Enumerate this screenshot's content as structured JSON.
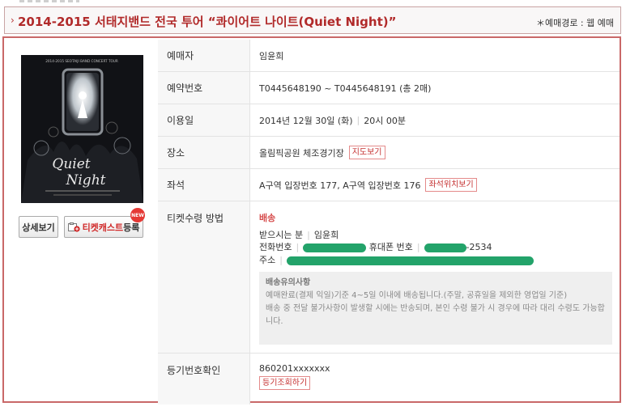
{
  "header": {
    "title": "2014-2015 서태지밴드 전국 투어 “콰이어트 나이트(Quiet Night)”",
    "route_label": "＊예매경로 : 웹 예매"
  },
  "poster": {
    "top_text": "2014-2015 SEOTAIJI BAND CONCERT TOUR",
    "logo_line1": "Quiet",
    "logo_line2": "Night"
  },
  "buttons": {
    "detail": "상세보기",
    "ticketcast_red": "티켓캐스트",
    "ticketcast_rest": "등록",
    "new_badge": "NEW"
  },
  "rows": {
    "booker": {
      "label": "예매자",
      "value": "임윤희"
    },
    "reservation": {
      "label": "예약번호",
      "value": "T0445648190 ~ T0445648191 (총 2매)"
    },
    "date": {
      "label": "이용일",
      "date": "2014년 12월 30일 (화)",
      "time": "20시 00분"
    },
    "venue": {
      "label": "장소",
      "value": "올림픽공원 체조경기장",
      "button": "지도보기"
    },
    "seat": {
      "label": "좌석",
      "value": "A구역 입장번호 177, A구역 입장번호 176",
      "button": "좌석위치보기"
    },
    "delivery": {
      "label": "티켓수령 방법",
      "method": "배송",
      "recipient_label": "받으시는 분",
      "recipient": "임윤희",
      "phone_label": "전화번호",
      "mobile_label": "휴대폰 번호",
      "mobile_tail": "-2534",
      "address_label": "주소",
      "notice_title": "배송유의사항",
      "notice_line1": "예매완료(결제 익일)기준 4~5일 이내에 배송됩니다.(주말, 공휴일을 제외한 영업일 기준)",
      "notice_line2": "배송 중 전달 불가사항이 발생할 시에는 반송되며, 본인 수령 불가 시 경우에 따라 대리 수령도 가능합니다."
    },
    "registered": {
      "label": "등기번호확인",
      "value": "860201xxxxxxx",
      "button": "등기조회하기"
    }
  },
  "colors": {
    "accent": "#b12a2a",
    "frame": "#c96868",
    "mask": "#23a36a"
  }
}
